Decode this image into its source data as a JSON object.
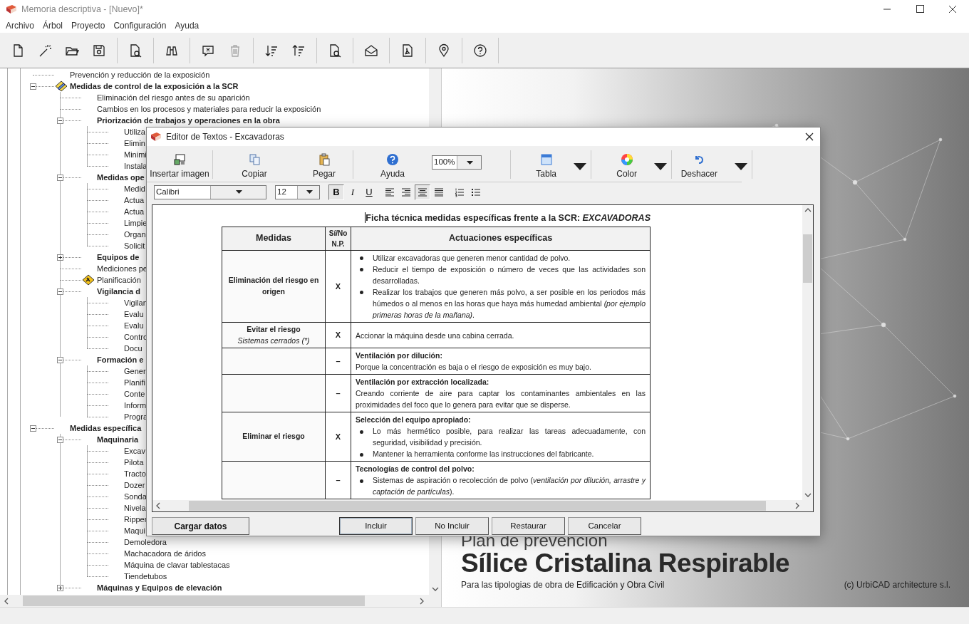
{
  "window": {
    "title": "Memoria descriptiva - [Nuevo]*"
  },
  "menu": [
    "Archivo",
    "Árbol",
    "Proyecto",
    "Configuración",
    "Ayuda"
  ],
  "toolbar": [
    [
      {
        "disabled": false
      },
      {
        "disabled": false
      },
      {
        "disabled": false
      },
      {
        "disabled": false
      }
    ],
    [
      {
        "disabled": false
      }
    ],
    [
      {
        "disabled": false
      }
    ],
    [
      {
        "disabled": false
      },
      {
        "disabled": true
      }
    ],
    [
      {
        "disabled": false
      },
      {
        "disabled": false
      }
    ],
    [
      {
        "disabled": false
      }
    ],
    [
      {
        "disabled": false
      }
    ],
    [
      {
        "disabled": false
      }
    ],
    [
      {
        "disabled": false
      }
    ],
    [
      {
        "disabled": false
      }
    ]
  ],
  "tree": [
    {
      "label": "Prevención y reducción de la exposición"
    },
    {
      "label": "Medidas de control de la exposición a la SCR",
      "expanded": true,
      "kind": "edit",
      "children": [
        {
          "label": "Eliminación del riesgo antes de su aparición"
        },
        {
          "label": "Cambios en los procesos y materiales para reducir la exposición"
        },
        {
          "label": "Priorización de trabajos y operaciones en la obra",
          "expanded": true,
          "children": [
            {
              "label": "Utiliza"
            },
            {
              "label": "Elimin"
            },
            {
              "label": "Minimi"
            },
            {
              "label": "Instala"
            }
          ]
        },
        {
          "label": "Medidas ope",
          "expanded": true,
          "children": [
            {
              "label": "Medid"
            },
            {
              "label": "Actua"
            },
            {
              "label": "Actua"
            },
            {
              "label": "Limpie"
            },
            {
              "label": "Organ"
            },
            {
              "label": "Solicit"
            }
          ]
        },
        {
          "label": "Equipos de",
          "expanded": false
        },
        {
          "label": "Mediciones pe"
        },
        {
          "label": "Planificación",
          "kind": "warning"
        },
        {
          "label": "Vigilancia d",
          "expanded": true,
          "children": [
            {
              "label": "Vigilan"
            },
            {
              "label": "Evalu"
            },
            {
              "label": "Evalu"
            },
            {
              "label": "Contro"
            },
            {
              "label": "Docu"
            }
          ]
        },
        {
          "label": "Formación e",
          "expanded": true,
          "children": [
            {
              "label": "Gener"
            },
            {
              "label": "Planifi"
            },
            {
              "label": "Conte"
            },
            {
              "label": "Inform"
            },
            {
              "label": "Progra"
            }
          ]
        }
      ]
    },
    {
      "label": "Medidas específica",
      "expanded": true,
      "children": [
        {
          "label": "Maquinaria",
          "expanded": true,
          "children": [
            {
              "label": "Excav"
            },
            {
              "label": "Pilota"
            },
            {
              "label": "Tracto"
            },
            {
              "label": "Dozer"
            },
            {
              "label": "Sonda"
            },
            {
              "label": "Nivela"
            },
            {
              "label": "Ripper"
            },
            {
              "label": "Maqui"
            },
            {
              "label": "Demoledora"
            },
            {
              "label": "Machacadora de áridos"
            },
            {
              "label": "Máquina de clavar tablestacas"
            },
            {
              "label": "Tiendetubos"
            }
          ]
        },
        {
          "label": "Máquinas y Equipos de elevación",
          "expanded": false
        }
      ]
    }
  ],
  "splash": {
    "heading": "Plan de prevención",
    "title": "Sílice Cristalina Respirable",
    "subtitle": "Para las tipologias de obra de Edificación y Obra Civil",
    "copyright": "(c)  UrbiCAD architecture s.l."
  },
  "dialog": {
    "title": "Editor de Textos - Excavadoras",
    "toolbar": [
      {
        "kind": "button",
        "label": "Insertar imagen"
      },
      {
        "kind": "button",
        "label": "Copiar"
      },
      {
        "kind": "button",
        "label": "Pegar"
      },
      {
        "kind": "button",
        "label": "Ayuda"
      },
      {
        "kind": "combo",
        "value": "100%"
      },
      {
        "kind": "dropdown",
        "label": "Tabla"
      },
      {
        "kind": "dropdown",
        "label": "Color"
      },
      {
        "kind": "dropdown",
        "label": "Deshacer"
      }
    ],
    "font": "Calibri",
    "size": "12",
    "styles": [
      {
        "label": "B",
        "pressed": true
      },
      {
        "label": "I",
        "pressed": false
      },
      {
        "label": "U",
        "pressed": false
      }
    ],
    "align": [
      {
        "selected": false
      },
      {
        "selected": false
      },
      {
        "selected": true
      },
      {
        "selected": false
      }
    ],
    "lists": [
      {
        "pressed": false
      },
      {
        "pressed": false
      }
    ],
    "document": {
      "title": "Ficha técnica medidas específicas frente a la SCR: *EXCAVADORAS*",
      "columns": [
        "Medidas",
        "Sí/No N.P.",
        "Actuaciones específicas"
      ],
      "rows": [
        {
          "measure": "Eliminación del riesgo en origen",
          "mark": "X",
          "bullets": [
            "Utilizar excavadoras que generen menor cantidad de polvo.",
            "Reducir el tiempo de exposición o número de veces que las actividades son desarrolladas.",
            "Realizar los trabajos que generen más polvo, a ser posible en los periodos más húmedos o al menos en las horas que haya más humedad ambiental *(por ejemplo primeras horas de la mañana)*."
          ]
        },
        {
          "measure": "Evitar el riesgo",
          "note": "Sistemas cerrados (*)",
          "mark": "X",
          "text": "Accionar la máquina desde una cabina cerrada."
        },
        {
          "mark": "–",
          "heading": "Ventilación por dilución:",
          "text": "Porque la concentración es baja o el riesgo de exposición es muy bajo."
        },
        {
          "mark": "–",
          "heading": "Ventilación por extracción localizada:",
          "text": "Creando corriente de aire para captar los contaminantes ambientales en las proximidades del foco que lo genera para evitar que se disperse."
        },
        {
          "measure": "Eliminar el riesgo",
          "mark": "X",
          "heading": "Selección del equipo apropiado:",
          "bullets": [
            "Lo más hermético posible, para realizar las tareas adecuadamente, con seguridad, visibilidad y precisión.",
            "Mantener la herramienta conforme las instrucciones del fabricante."
          ]
        },
        {
          "mark": "–",
          "heading": "Tecnologías de control del polvo:",
          "bullets": [
            "Sistemas de aspiración o recolección de polvo (*ventilación por dilución, arrastre y captación de partículas*)."
          ]
        }
      ]
    },
    "buttons": [
      {
        "label": "Cargar datos",
        "kind": "strong"
      },
      {
        "label": "Incluir",
        "kind": "default"
      },
      {
        "label": "No Incluir",
        "kind": "normal"
      },
      {
        "label": "Restaurar",
        "kind": "normal"
      },
      {
        "label": "Cancelar",
        "kind": "normal"
      }
    ]
  }
}
